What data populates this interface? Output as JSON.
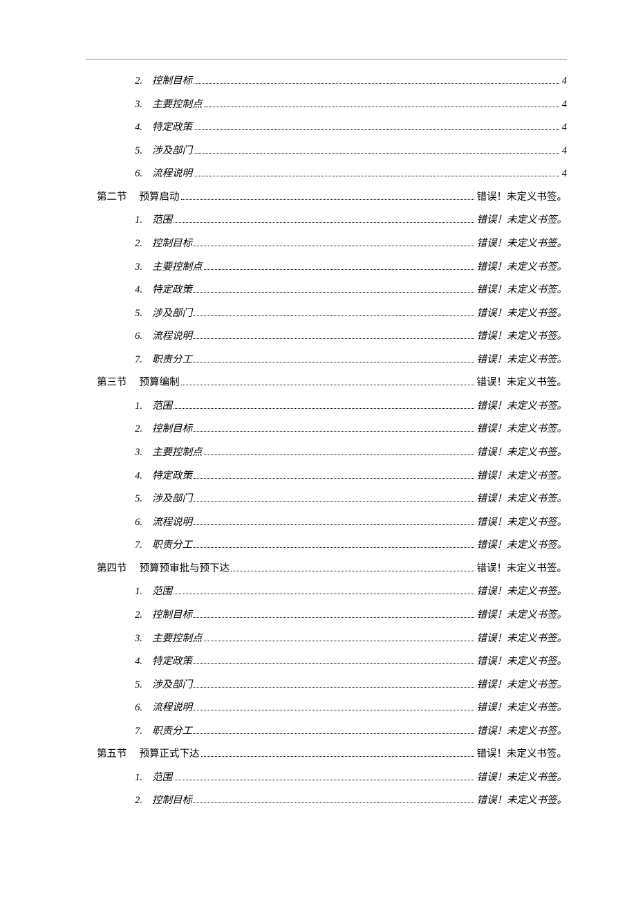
{
  "error_text_section": "错误！未定义书签。",
  "error_text_item": "错误！未定义书签。",
  "toc": [
    {
      "level": "item",
      "num": "2.",
      "title": "控制目标",
      "page": "4"
    },
    {
      "level": "item",
      "num": "3.",
      "title": "主要控制点",
      "page": "4"
    },
    {
      "level": "item",
      "num": "4.",
      "title": "特定政策",
      "page": "4"
    },
    {
      "level": "item",
      "num": "5.",
      "title": "涉及部门",
      "page": "4"
    },
    {
      "level": "item",
      "num": "6.",
      "title": "流程说明",
      "page": "4"
    },
    {
      "level": "section",
      "num": "第二节",
      "title": "预算启动",
      "page": "err"
    },
    {
      "level": "item",
      "num": "1.",
      "title": "范围",
      "page": "err"
    },
    {
      "level": "item",
      "num": "2.",
      "title": "控制目标",
      "page": "err"
    },
    {
      "level": "item",
      "num": "3.",
      "title": "主要控制点",
      "page": "err"
    },
    {
      "level": "item",
      "num": "4.",
      "title": "特定政策",
      "page": "err"
    },
    {
      "level": "item",
      "num": "5.",
      "title": "涉及部门",
      "page": "err"
    },
    {
      "level": "item",
      "num": "6.",
      "title": "流程说明",
      "page": "err"
    },
    {
      "level": "item",
      "num": "7.",
      "title": "职责分工",
      "page": "err"
    },
    {
      "level": "section",
      "num": "第三节",
      "title": "预算编制",
      "page": "err"
    },
    {
      "level": "item",
      "num": "1.",
      "title": "范围",
      "page": "err"
    },
    {
      "level": "item",
      "num": "2.",
      "title": "控制目标",
      "page": "err"
    },
    {
      "level": "item",
      "num": "3.",
      "title": "主要控制点",
      "page": "err"
    },
    {
      "level": "item",
      "num": "4.",
      "title": "特定政策",
      "page": "err"
    },
    {
      "level": "item",
      "num": "5.",
      "title": "涉及部门",
      "page": "err"
    },
    {
      "level": "item",
      "num": "6.",
      "title": "流程说明",
      "page": "err"
    },
    {
      "level": "item",
      "num": "7.",
      "title": "职责分工",
      "page": "err"
    },
    {
      "level": "section",
      "num": "第四节",
      "title": "预算预审批与预下达",
      "page": "err"
    },
    {
      "level": "item",
      "num": "1.",
      "title": "范围",
      "page": "err"
    },
    {
      "level": "item",
      "num": "2.",
      "title": "控制目标",
      "page": "err"
    },
    {
      "level": "item",
      "num": "3.",
      "title": "主要控制点",
      "page": "err"
    },
    {
      "level": "item",
      "num": "4.",
      "title": "特定政策",
      "page": "err"
    },
    {
      "level": "item",
      "num": "5.",
      "title": "涉及部门",
      "page": "err"
    },
    {
      "level": "item",
      "num": "6.",
      "title": "流程说明",
      "page": "err"
    },
    {
      "level": "item",
      "num": "7.",
      "title": "职责分工",
      "page": "err"
    },
    {
      "level": "section",
      "num": "第五节",
      "title": "预算正式下达",
      "page": "err"
    },
    {
      "level": "item",
      "num": "1.",
      "title": "范围",
      "page": "err"
    },
    {
      "level": "item",
      "num": "2.",
      "title": "控制目标",
      "page": "err"
    }
  ]
}
